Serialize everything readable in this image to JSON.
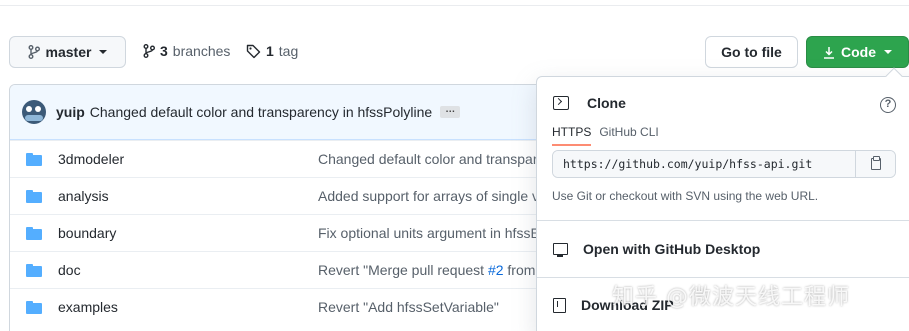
{
  "toolbar": {
    "branch_label": "master",
    "branches_count": "3",
    "branches_label": "branches",
    "tags_count": "1",
    "tags_label": "tag",
    "goto_file_label": "Go to file",
    "code_label": "Code"
  },
  "commit": {
    "user": "yuip",
    "message": "Changed default color and transparency in hfssPolyline",
    "ellipsis": "…"
  },
  "files": [
    {
      "name": "3dmodeler",
      "message": "Changed default color and transpar"
    },
    {
      "name": "analysis",
      "message": "Added support for arrays of single v"
    },
    {
      "name": "boundary",
      "message": "Fix optional units argument in hfssE"
    },
    {
      "name": "doc",
      "message_pre": "Revert \"Merge pull request ",
      "message_link": "#2",
      "message_post": " from"
    },
    {
      "name": "examples",
      "message": "Revert \"Add hfssSetVariable\""
    }
  ],
  "clone": {
    "title": "Clone",
    "help": "?",
    "tabs": [
      "HTTPS",
      "GitHub CLI"
    ],
    "url": "https://github.com/yuip/hfss-api.git",
    "hint": "Use Git or checkout with SVN using the web URL.",
    "open_desktop_label": "Open with GitHub Desktop",
    "download_zip_label": "Download ZIP"
  },
  "watermark": "知乎 @微波天线工程师",
  "colors": {
    "code_button": "#2da44e",
    "folder": "#54aeff",
    "link": "#0969da",
    "active_tab_underline": "#fd8c73"
  },
  "icons": [
    "branch-icon",
    "git-branch-icon",
    "tag-icon",
    "download-icon",
    "folder-icon",
    "terminal-icon",
    "question-icon",
    "copy-icon",
    "desktop-download-icon",
    "file-zip-icon"
  ]
}
